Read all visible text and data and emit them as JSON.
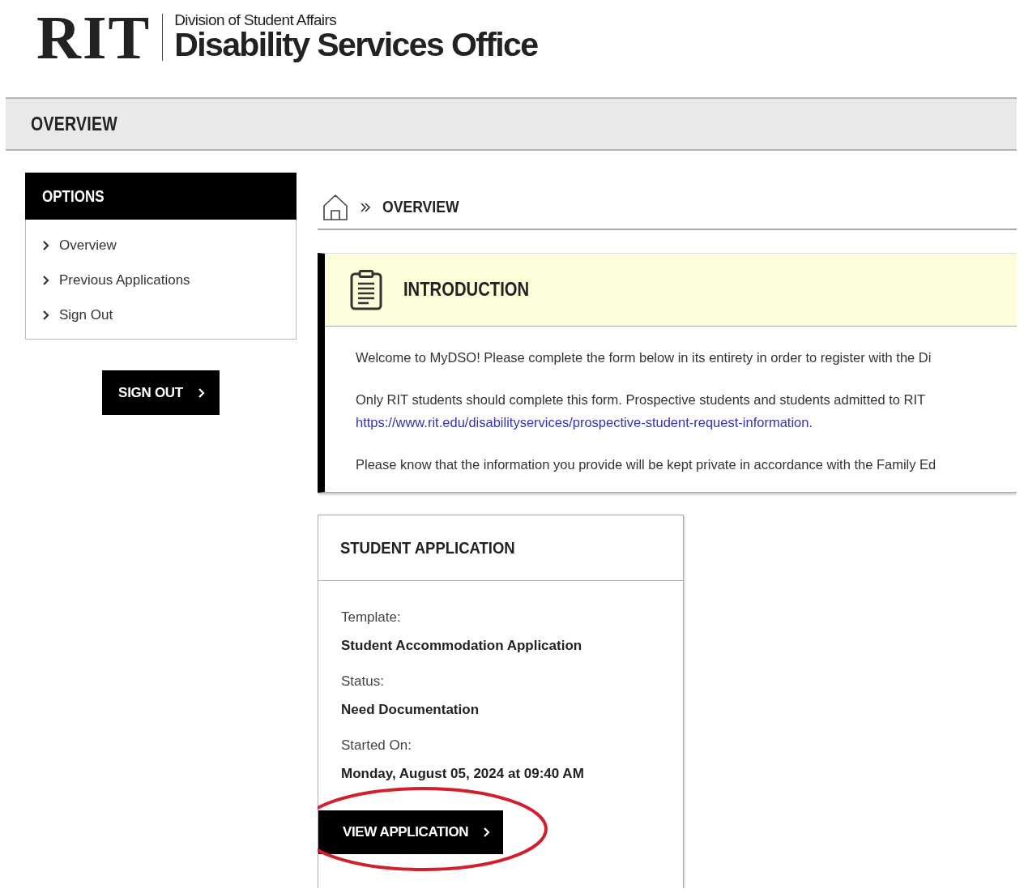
{
  "logo": {
    "mark": "RIT",
    "division": "Division of Student Affairs",
    "office": "Disability Services Office"
  },
  "page_title": "OVERVIEW",
  "sidebar": {
    "title": "OPTIONS",
    "items": [
      {
        "label": "Overview"
      },
      {
        "label": "Previous Applications"
      },
      {
        "label": "Sign Out"
      }
    ],
    "button": "SIGN OUT"
  },
  "breadcrumb": {
    "current": "OVERVIEW"
  },
  "introduction": {
    "title": "INTRODUCTION",
    "paragraphs": [
      {
        "text": "Welcome to MyDSO! Please complete the form below in its entirety in order to register with the Di"
      },
      {
        "text": "Only RIT students should complete this form. Prospective students and students admitted to RIT",
        "link": "https://www.rit.edu/disabilityservices/prospective-student-request-information."
      },
      {
        "text": "Please know that the information you provide will be kept private in accordance with the Family Ed"
      }
    ]
  },
  "application": {
    "title": "STUDENT APPLICATION",
    "fields": [
      {
        "label": "Template:",
        "value": "Student Accommodation Application"
      },
      {
        "label": "Status:",
        "value": "Need Documentation"
      },
      {
        "label": "Started On:",
        "value": "Monday, August 05, 2024 at 09:40 AM"
      }
    ],
    "button": {
      "label": "VIEW APPLICATION",
      "circled": true
    }
  }
}
